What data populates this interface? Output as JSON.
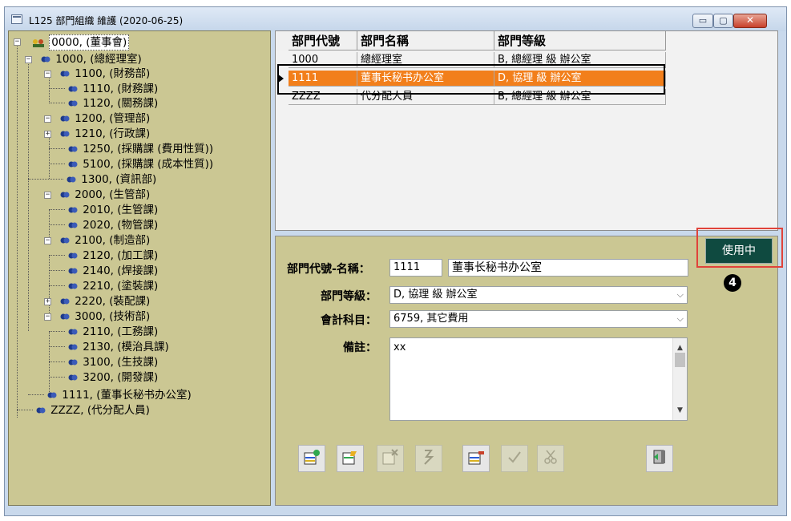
{
  "window": {
    "title": "L125 部門組織 維護 (2020-06-25)",
    "controls": {
      "minimize": "▭",
      "maximize": "▢",
      "close": "✕"
    }
  },
  "tree": {
    "nodes": [
      {
        "code": "0000,",
        "name": "(董事會)",
        "level": 0,
        "expanded": true
      },
      {
        "code": "1000,",
        "name": "(總經理室)",
        "level": 1,
        "expanded": true
      },
      {
        "code": "1100,",
        "name": "(財務部)",
        "level": 2,
        "expanded": true
      },
      {
        "code": "1110,",
        "name": "(財務課)",
        "level": 3
      },
      {
        "code": "1120,",
        "name": "(關務課)",
        "level": 3
      },
      {
        "code": "1200,",
        "name": "(管理部)",
        "level": 2,
        "expanded": true
      },
      {
        "code": "1210,",
        "name": "(行政課)",
        "level": 3,
        "collapsed": true
      },
      {
        "code": "1250,",
        "name": "(採購課 (費用性質))",
        "level": 3
      },
      {
        "code": "5100,",
        "name": "(採購課 (成本性質))",
        "level": 3
      },
      {
        "code": "1300,",
        "name": "(資訊部)",
        "level": 2
      },
      {
        "code": "2000,",
        "name": "(生管部)",
        "level": 2,
        "expanded": true
      },
      {
        "code": "2010,",
        "name": "(生管課)",
        "level": 3
      },
      {
        "code": "2020,",
        "name": "(物管課)",
        "level": 3
      },
      {
        "code": "2100,",
        "name": "(制造部)",
        "level": 2,
        "expanded": true
      },
      {
        "code": "2120,",
        "name": "(加工課)",
        "level": 3
      },
      {
        "code": "2140,",
        "name": "(焊接課)",
        "level": 3
      },
      {
        "code": "2210,",
        "name": "(塗裝課)",
        "level": 3
      },
      {
        "code": "2220,",
        "name": "(裝配課)",
        "level": 3,
        "collapsed": true
      },
      {
        "code": "3000,",
        "name": "(技術部)",
        "level": 2,
        "expanded": true
      },
      {
        "code": "2110,",
        "name": "(工務課)",
        "level": 3
      },
      {
        "code": "2130,",
        "name": "(模治具課)",
        "level": 3
      },
      {
        "code": "3100,",
        "name": "(生技課)",
        "level": 3
      },
      {
        "code": "3200,",
        "name": "(開發課)",
        "level": 3
      },
      {
        "code": "1111,",
        "name": "(董事长秘书办公室)",
        "level": 1
      },
      {
        "code": "ZZZZ,",
        "name": "(代分配人員)",
        "level": 1
      }
    ]
  },
  "grid": {
    "columns": [
      "部門代號",
      "部門名稱",
      "部門等級"
    ],
    "rows": [
      {
        "code": "1000",
        "name": "總經理室",
        "grade": "B, 總經理 級 辦公室"
      },
      {
        "code": "1111",
        "name": "董事长秘书办公室",
        "grade": "D, 協理 級 辦公室",
        "selected": true
      },
      {
        "code": "ZZZZ",
        "name": "代分配人員",
        "grade": "B, 總經理 級 辦公室"
      }
    ]
  },
  "form": {
    "code_name_label": "部門代號-名稱：",
    "code_value": "1111",
    "name_value": "董事长秘书办公室",
    "grade_label": "部門等級：",
    "grade_value": "D, 協理 級 辦公室",
    "account_label": "會計科目：",
    "account_value": "6759, 其它費用",
    "notes_label": "備註：",
    "notes_value": "xx"
  },
  "status": {
    "label": "使用中"
  },
  "annotation": {
    "step": "4"
  },
  "colors": {
    "selected_row": "#f27f1b",
    "panel": "#cbc793",
    "status_bg": "#0f4a40",
    "callout": "#e0433a"
  },
  "toolbar": {
    "buttons": [
      {
        "icon": "add-record-icon",
        "enabled": true
      },
      {
        "icon": "edit-record-icon",
        "enabled": true
      },
      {
        "icon": "delete-record-icon",
        "enabled": false
      },
      {
        "icon": "query-icon",
        "enabled": false
      },
      {
        "icon": "copy-record-icon",
        "enabled": true
      },
      {
        "icon": "confirm-icon",
        "enabled": false
      },
      {
        "icon": "cancel-icon",
        "enabled": false
      },
      {
        "icon": "exit-icon",
        "enabled": true
      }
    ]
  }
}
